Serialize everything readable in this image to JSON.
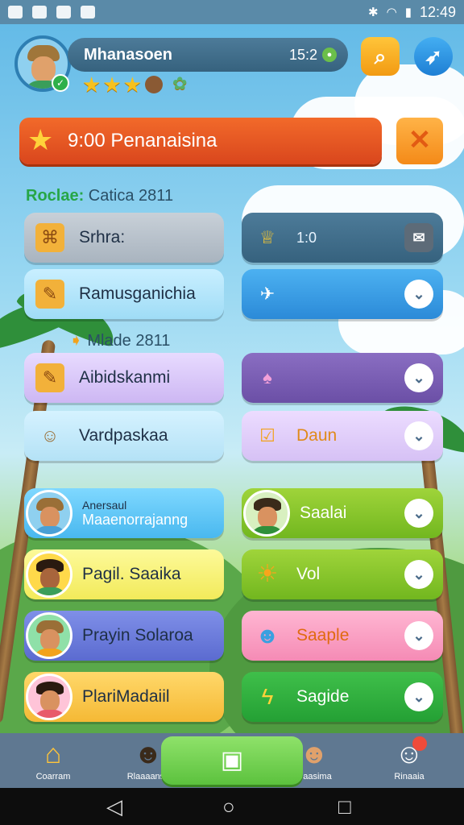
{
  "status_bar": {
    "time": "12:49",
    "icons": [
      "wifi-icon",
      "signal-icon",
      "battery-icon",
      "bluetooth-icon"
    ]
  },
  "header": {
    "player_name": "Mhanasoen",
    "score": "15:2",
    "rating_stars": 3
  },
  "promo": {
    "text": "9:00 Penanaisina"
  },
  "section1": {
    "prefix": "Roclae:",
    "text": " Catica 2811"
  },
  "section2": {
    "text": "Mlade 2811"
  },
  "rows": [
    {
      "left_label": "Srhra:",
      "right_label": "1:0"
    },
    {
      "left_label": "Ramusganichia",
      "right_label": ""
    },
    {
      "left_label": "Aibidskanmi",
      "right_label": ""
    },
    {
      "left_label": "Vardpaskaa",
      "right_label": "Daun"
    },
    {
      "left_top": "Anersaul",
      "left_label": "Maaenorrajanng",
      "right_label": "Saalai"
    },
    {
      "left_label": "Pagil. Saaika",
      "right_label": "Vol"
    },
    {
      "left_label": "Prayin Solaroa",
      "right_label": "Saaple"
    },
    {
      "left_label": "PlariMadaiil",
      "right_label": "Sagide"
    }
  ],
  "bottom_nav": [
    {
      "label": "Coarram",
      "icon": "home-icon"
    },
    {
      "label": "Rlaaaansa",
      "icon": "avatar-icon"
    },
    {
      "label": "",
      "icon": "card-icon"
    },
    {
      "label": "Caasima",
      "icon": "avatar-icon"
    },
    {
      "label": "Rinaaia",
      "icon": "avatar-icon"
    }
  ],
  "colors": {
    "promo": "#e8552a",
    "orange": "#f29a12",
    "blue": "#1e7fd4",
    "green": "#5cc23e"
  }
}
